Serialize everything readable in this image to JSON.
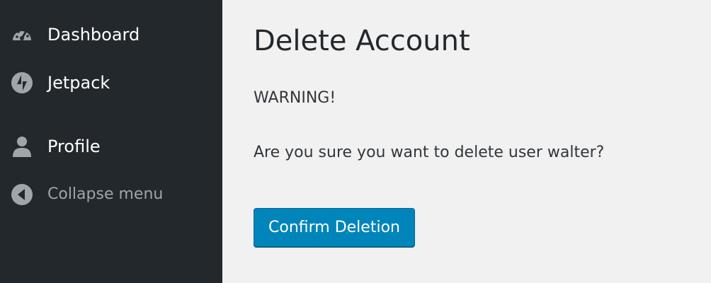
{
  "sidebar": {
    "items": [
      {
        "label": "Dashboard",
        "icon": "dashboard-gauge-icon"
      },
      {
        "label": "Jetpack",
        "icon": "jetpack-icon"
      },
      {
        "label": "Profile",
        "icon": "user-icon"
      },
      {
        "label": "Collapse menu",
        "icon": "collapse-arrow-icon"
      }
    ]
  },
  "main": {
    "title": "Delete Account",
    "warning": "WARNING!",
    "question": "Are you sure you want to delete user walter?",
    "confirm_label": "Confirm Deletion"
  },
  "colors": {
    "sidebar_bg": "#23282d",
    "main_bg": "#f1f1f1",
    "primary_button": "#0085ba",
    "muted_text": "#a0a5aa"
  }
}
